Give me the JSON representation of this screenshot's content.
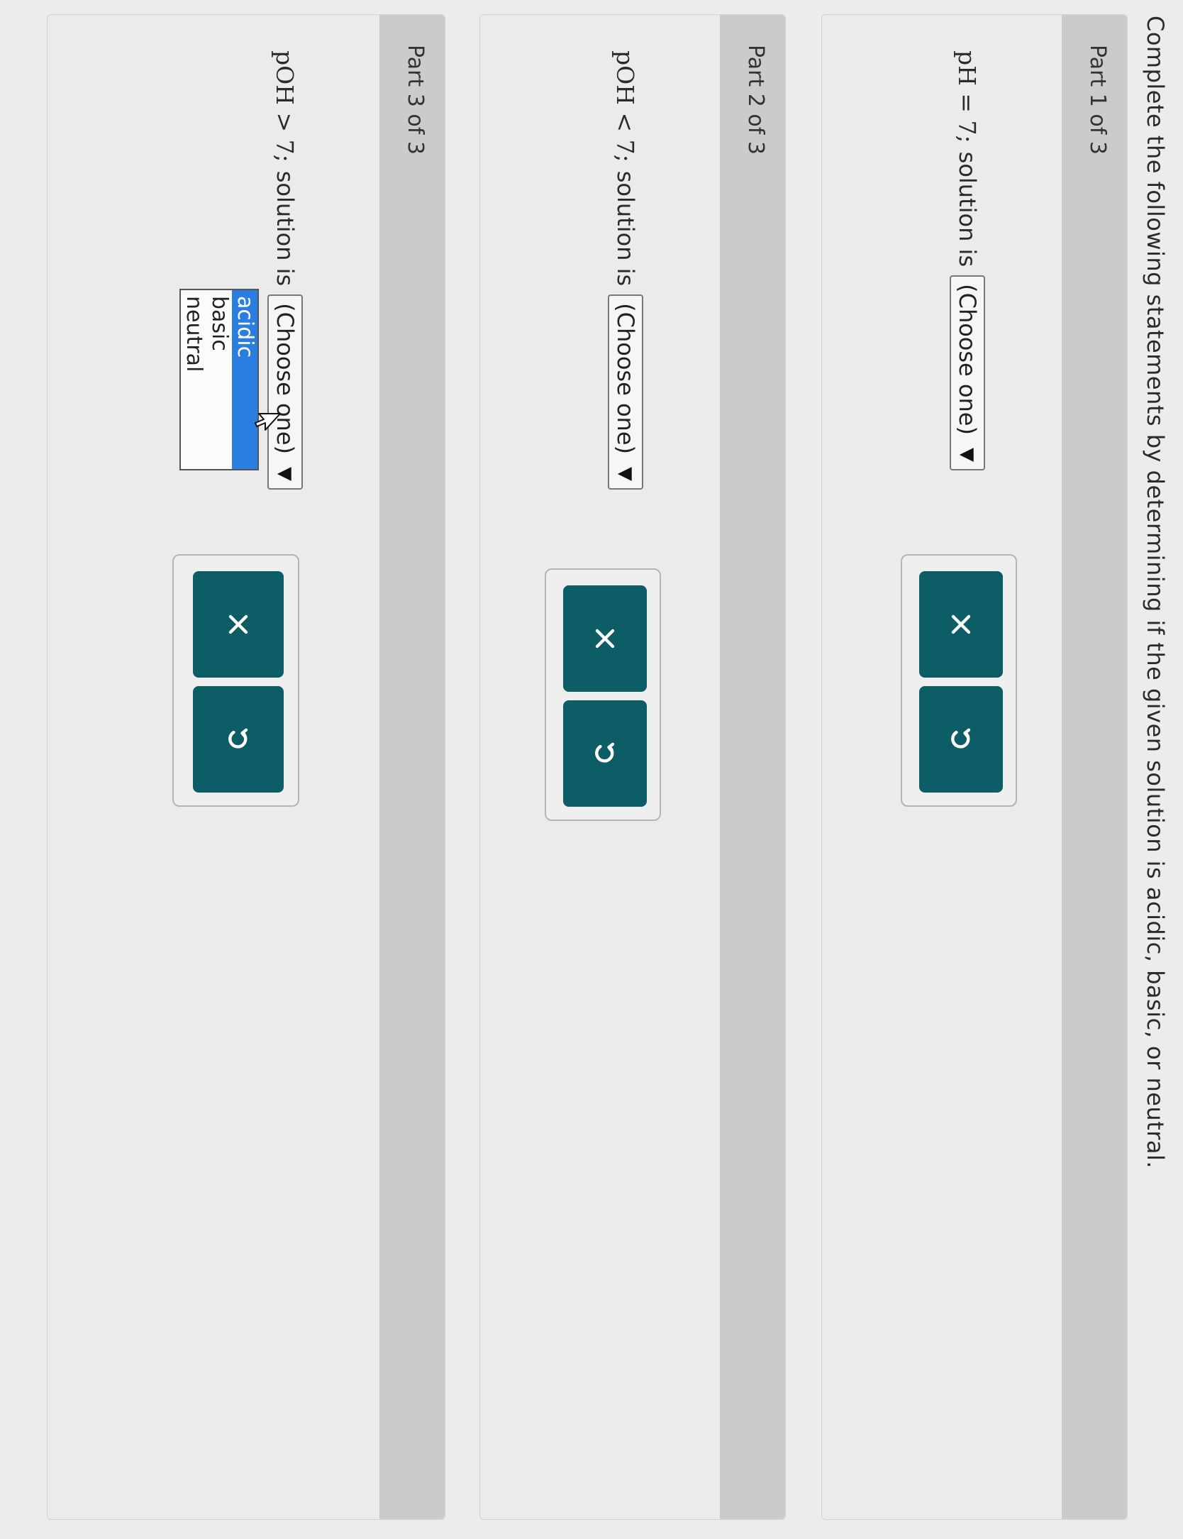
{
  "instructions": "Complete the following statements by determining if the given solution is acidic, basic, or neutral.",
  "parts": [
    {
      "label": "Part 1 of 3",
      "statement_math": "pH = 7;",
      "statement_text": "solution is",
      "select_value": "(Choose one)",
      "dropdown_open": false
    },
    {
      "label": "Part 2 of 3",
      "statement_math": "pOH < 7;",
      "statement_text": "solution is",
      "select_value": "(Choose one)",
      "dropdown_open": false
    },
    {
      "label": "Part 3 of 3",
      "statement_math": "pOH > 7;",
      "statement_text": "solution is",
      "select_value": "(Choose one)",
      "dropdown_open": true,
      "options": [
        "acidic",
        "basic",
        "neutral"
      ],
      "highlighted_option": "acidic"
    }
  ],
  "buttons": {
    "clear_icon": "x-icon",
    "undo_icon": "undo-icon"
  },
  "colors": {
    "button_bg": "#0d5d66",
    "header_bg": "#c9cccb",
    "highlight": "#2a7de1"
  }
}
